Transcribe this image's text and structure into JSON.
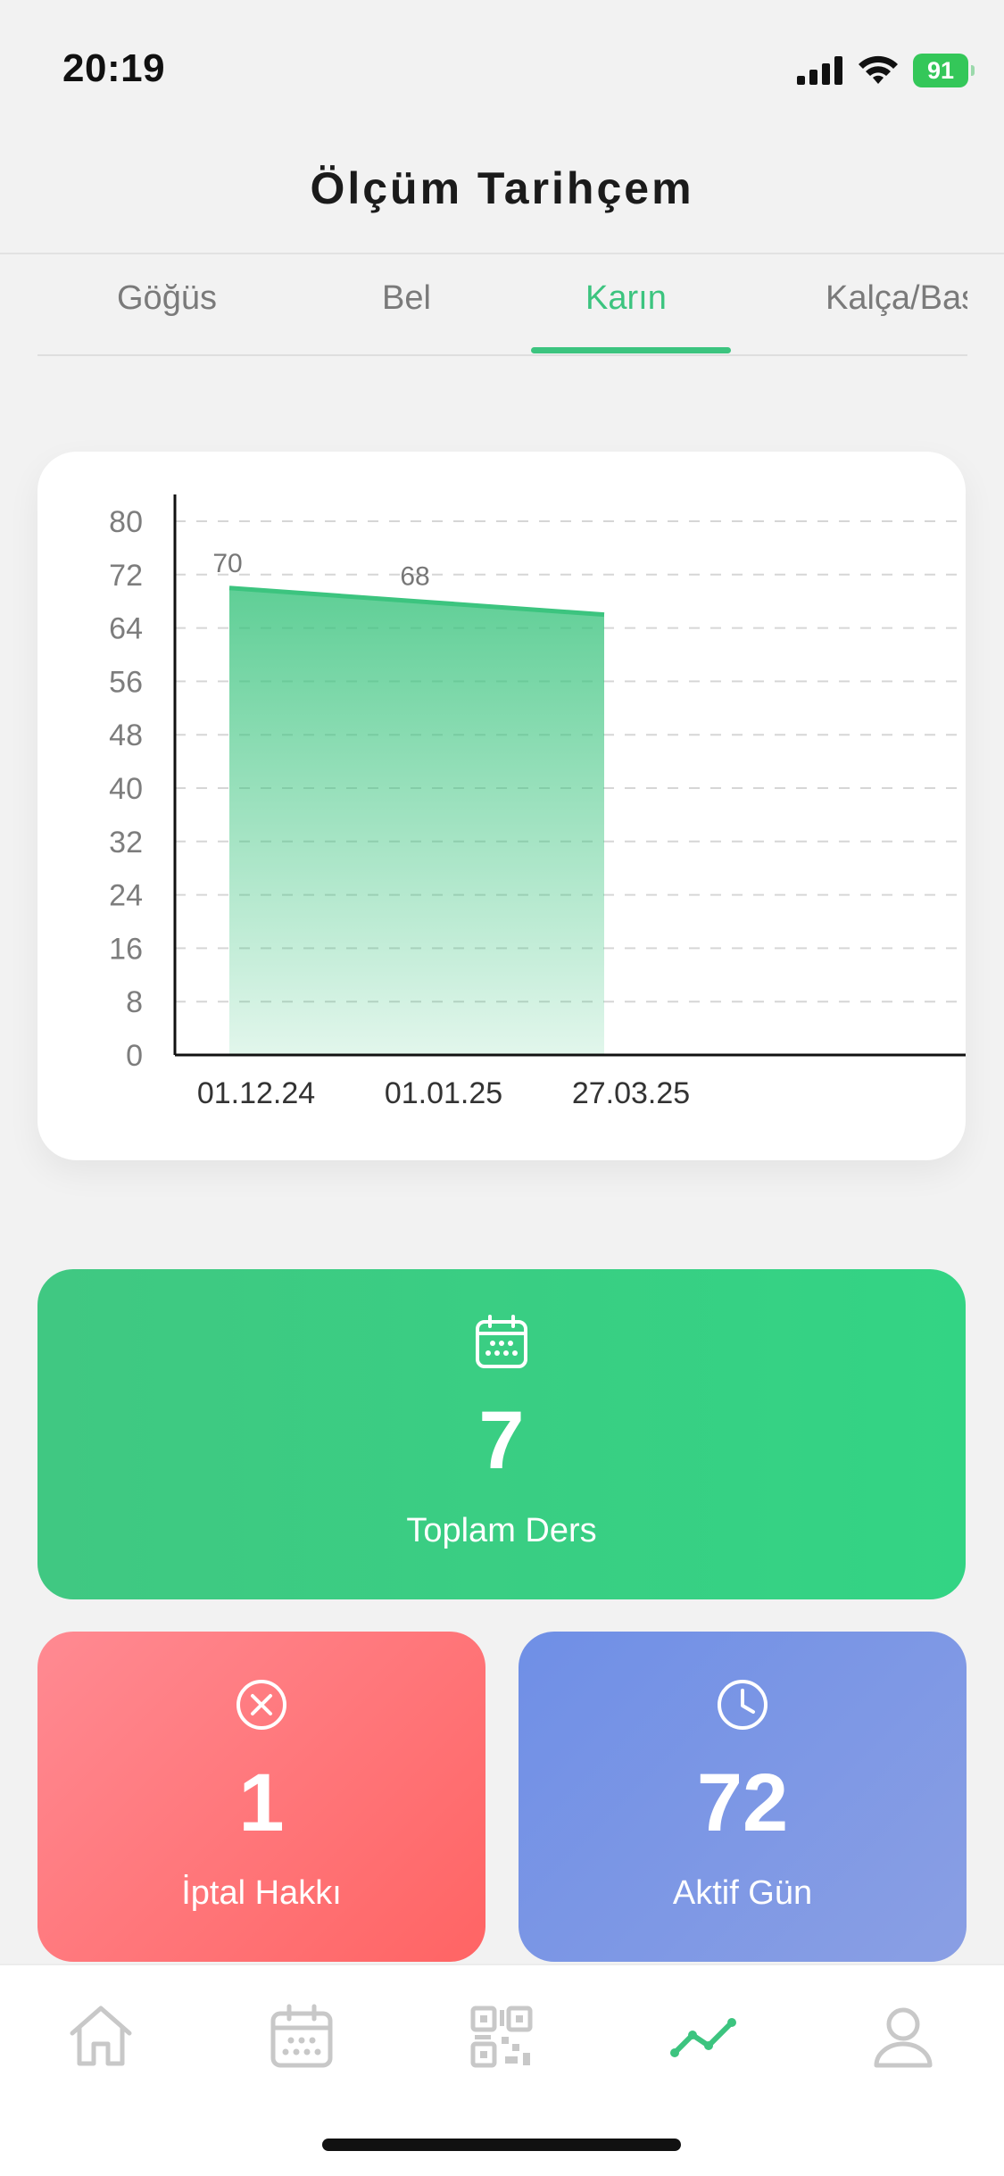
{
  "status_bar": {
    "time": "20:19",
    "battery": "91"
  },
  "header": {
    "title": "Ölçüm Tarihçem"
  },
  "tabs": [
    {
      "label": "Göğüs",
      "active": false
    },
    {
      "label": "Bel",
      "active": false
    },
    {
      "label": "Karın",
      "active": true
    },
    {
      "label": "Kalça/Basen",
      "active": false
    }
  ],
  "chart_data": {
    "type": "area",
    "categories": [
      "01.12.24",
      "01.01.25",
      "27.03.25"
    ],
    "values": [
      70,
      68,
      66
    ],
    "data_labels": [
      "70",
      "68",
      ""
    ],
    "ylim": [
      0,
      80
    ],
    "y_ticks": [
      0,
      8,
      16,
      24,
      32,
      40,
      48,
      56,
      64,
      72,
      80
    ],
    "grid": true,
    "fill_color": "#3cc47f"
  },
  "stats": {
    "total_lessons": {
      "value": "7",
      "label": "Toplam Ders"
    },
    "cancel_rights": {
      "value": "1",
      "label": "İptal Hakkı"
    },
    "active_days": {
      "value": "72",
      "label": "Aktif Gün"
    }
  },
  "colors": {
    "accent": "#3cc47f",
    "red": "#ff6e73",
    "blue": "#7b93e5"
  },
  "nav": [
    {
      "icon": "home-icon",
      "active": false
    },
    {
      "icon": "calendar-icon",
      "active": false
    },
    {
      "icon": "qr-code-icon",
      "active": false
    },
    {
      "icon": "stats-trend-icon",
      "active": true
    },
    {
      "icon": "profile-icon",
      "active": false
    }
  ]
}
